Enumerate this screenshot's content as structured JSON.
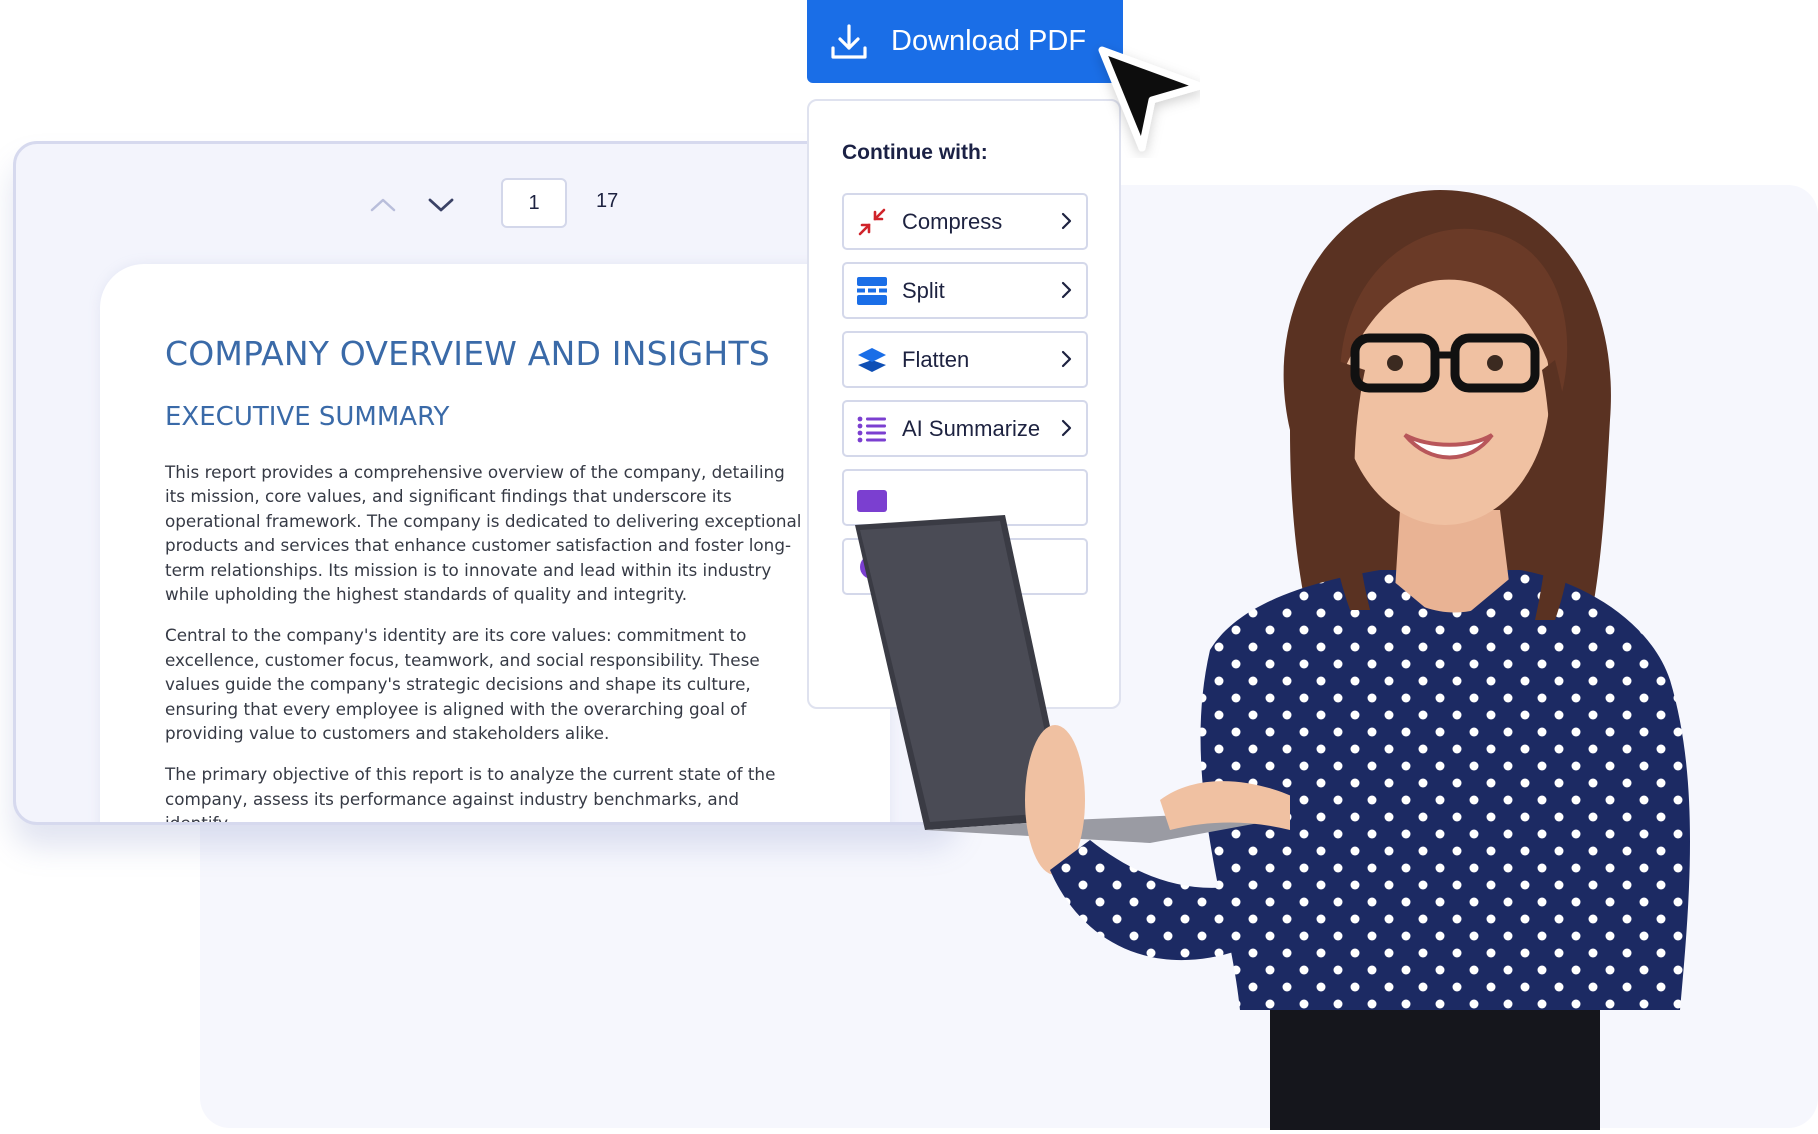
{
  "viewer": {
    "current_page": "1",
    "total_pages": "17"
  },
  "document": {
    "title": "COMPANY OVERVIEW AND INSIGHTS",
    "subtitle": "EXECUTIVE SUMMARY",
    "paragraphs": [
      "This report provides a comprehensive overview of the company, detailing its mission, core values, and significant findings that underscore its operational framework. The company is dedicated to delivering exceptional products and services that enhance customer satisfaction and foster long-term relationships. Its mission is to innovate and lead within its industry while upholding the highest standards of quality and integrity.",
      "Central to the company's identity are its core values: commitment to excellence, customer focus, teamwork, and social responsibility. These values guide the company's strategic decisions and shape its culture, ensuring that every employee is aligned with the overarching goal of providing value to customers and stakeholders alike.",
      "The primary objective of this report is to analyze the current state of the company, assess its performance against industry benchmarks, and identify"
    ]
  },
  "download_button": {
    "label": "Download PDF"
  },
  "continue_panel": {
    "title": "Continue with:",
    "options": [
      {
        "label": "Compress",
        "icon": "compress-icon"
      },
      {
        "label": "Split",
        "icon": "split-icon"
      },
      {
        "label": "Flatten",
        "icon": "flatten-icon"
      },
      {
        "label": "AI Summarize",
        "icon": "ai-summarize-icon"
      }
    ]
  },
  "colors": {
    "accent": "#1a6ee7",
    "doc_heading": "#3a6aa8",
    "compress_icon": "#d0232a",
    "ai_icon": "#7b3fd0"
  }
}
